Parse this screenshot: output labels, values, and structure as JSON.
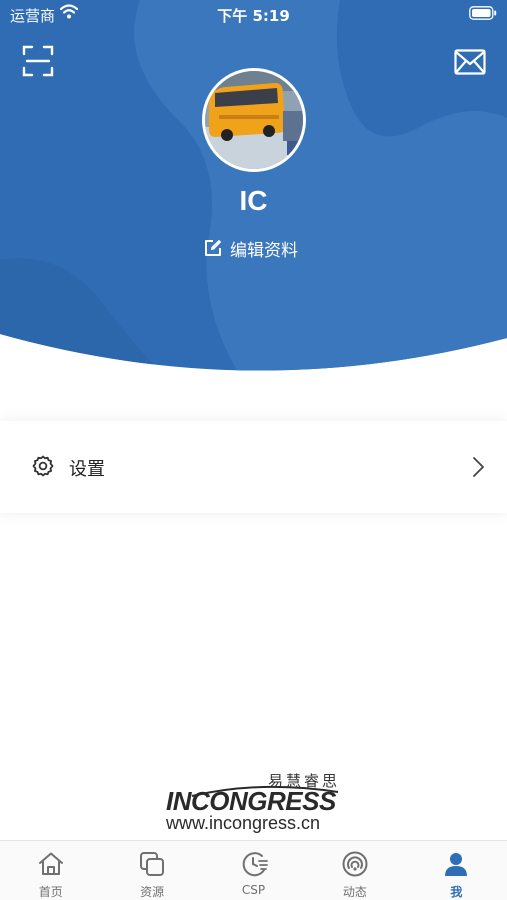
{
  "status_bar": {
    "carrier": "运营商",
    "time": "下午 5:19"
  },
  "profile": {
    "username": "IC",
    "edit_label": "编辑资料"
  },
  "menu": {
    "settings_label": "设置"
  },
  "logo": {
    "chinese": "易慧睿思",
    "wordmark": "INCONGRESS",
    "url": "www.incongress.cn"
  },
  "tabbar": {
    "tabs": [
      {
        "label": "首页",
        "icon": "home-icon"
      },
      {
        "label": "资源",
        "icon": "resources-icon"
      },
      {
        "label": "CSP",
        "icon": "csp-icon"
      },
      {
        "label": "动态",
        "icon": "activity-icon"
      },
      {
        "label": "我",
        "icon": "profile-icon"
      }
    ],
    "active_index": 4
  },
  "colors": {
    "header_blue": "#2f6cb4",
    "header_blue_light": "#3d7bc0",
    "active_tab": "#2f6db5",
    "inactive_tab": "#707070"
  }
}
